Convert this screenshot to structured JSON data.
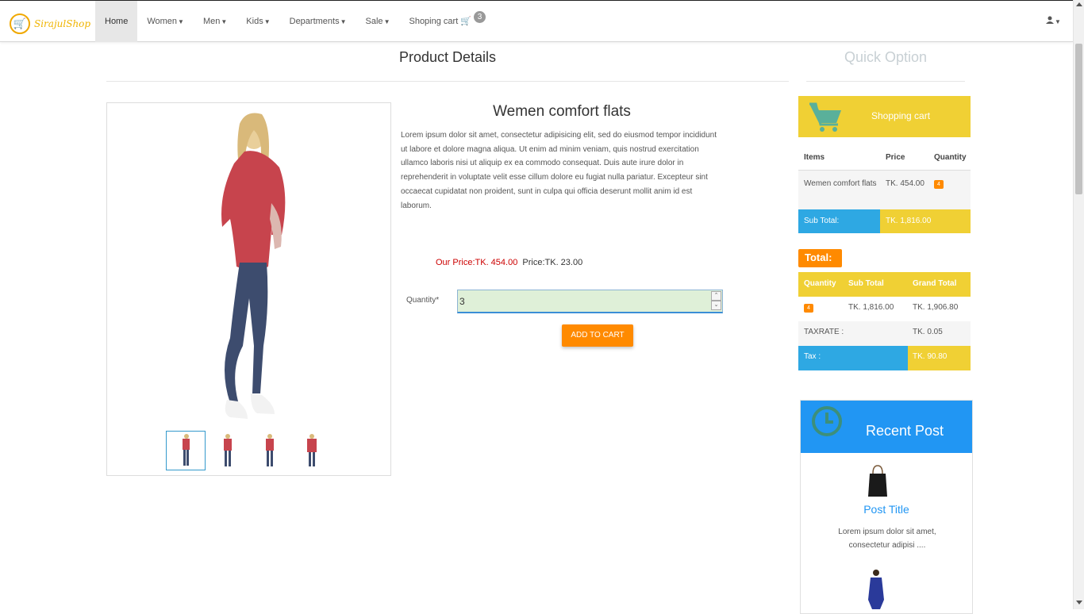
{
  "brand": {
    "name": "SirajulShop"
  },
  "nav": {
    "items": [
      {
        "label": "Home",
        "active": true
      },
      {
        "label": "Women"
      },
      {
        "label": "Men"
      },
      {
        "label": "Kids"
      },
      {
        "label": "Departments"
      },
      {
        "label": "Sale"
      }
    ],
    "cart_label": "Shoping cart",
    "cart_count": "3",
    "user_icon": "user-icon"
  },
  "main": {
    "title": "Product Details",
    "product_name": "Wemen comfort flats",
    "description": "Lorem ipsum dolor sit amet, consectetur adipisicing elit, sed do eiusmod tempor incididunt ut labore et dolore magna aliqua. Ut enim ad minim veniam, quis nostrud exercitation ullamco laboris nisi ut aliquip ex ea commodo consequat. Duis aute irure dolor in reprehenderit in voluptate velit esse cillum dolore eu fugiat nulla pariatur. Excepteur sint occaecat cupidatat non proident, sunt in culpa qui officia deserunt mollit anim id est laborum.",
    "our_price": "Our Price:TK. 454.00",
    "price": "Price:TK. 23.00",
    "quantity_label": "Quantity*",
    "quantity_value": "3",
    "add_to_cart": "ADD TO CART"
  },
  "sidebar": {
    "quick_title": "Quick Option",
    "cart_title": "Shopping cart",
    "cart_headers": [
      "Items",
      "Price",
      "Quantity"
    ],
    "cart_items": [
      {
        "name": "Wemen comfort flats",
        "price": "TK. 454.00",
        "qty": "4"
      }
    ],
    "sub_total_label": "Sub Total:",
    "sub_total_value": "TK. 1,816.00",
    "total_label": "Total:",
    "total_headers": [
      "Quantity",
      "Sub Total",
      "Grand Total"
    ],
    "total_row": {
      "qty": "4",
      "sub_total": "TK. 1,816.00",
      "grand_total": "TK. 1,906.80"
    },
    "taxrate_label": "TAXRATE :",
    "taxrate_value": "TK. 0.05",
    "tax_label": "Tax :",
    "tax_value": "TK. 90.80",
    "recent_title": "Recent Post",
    "post_title": "Post Title",
    "post_text": "Lorem ipsum dolor sit amet, consectetur adipisi ...."
  },
  "colors": {
    "accent_yellow": "#f0d034",
    "accent_blue": "#2ea8e3",
    "accent_orange": "#ff8a00",
    "price_red": "#cc0000",
    "recent_blue": "#2196f3"
  }
}
